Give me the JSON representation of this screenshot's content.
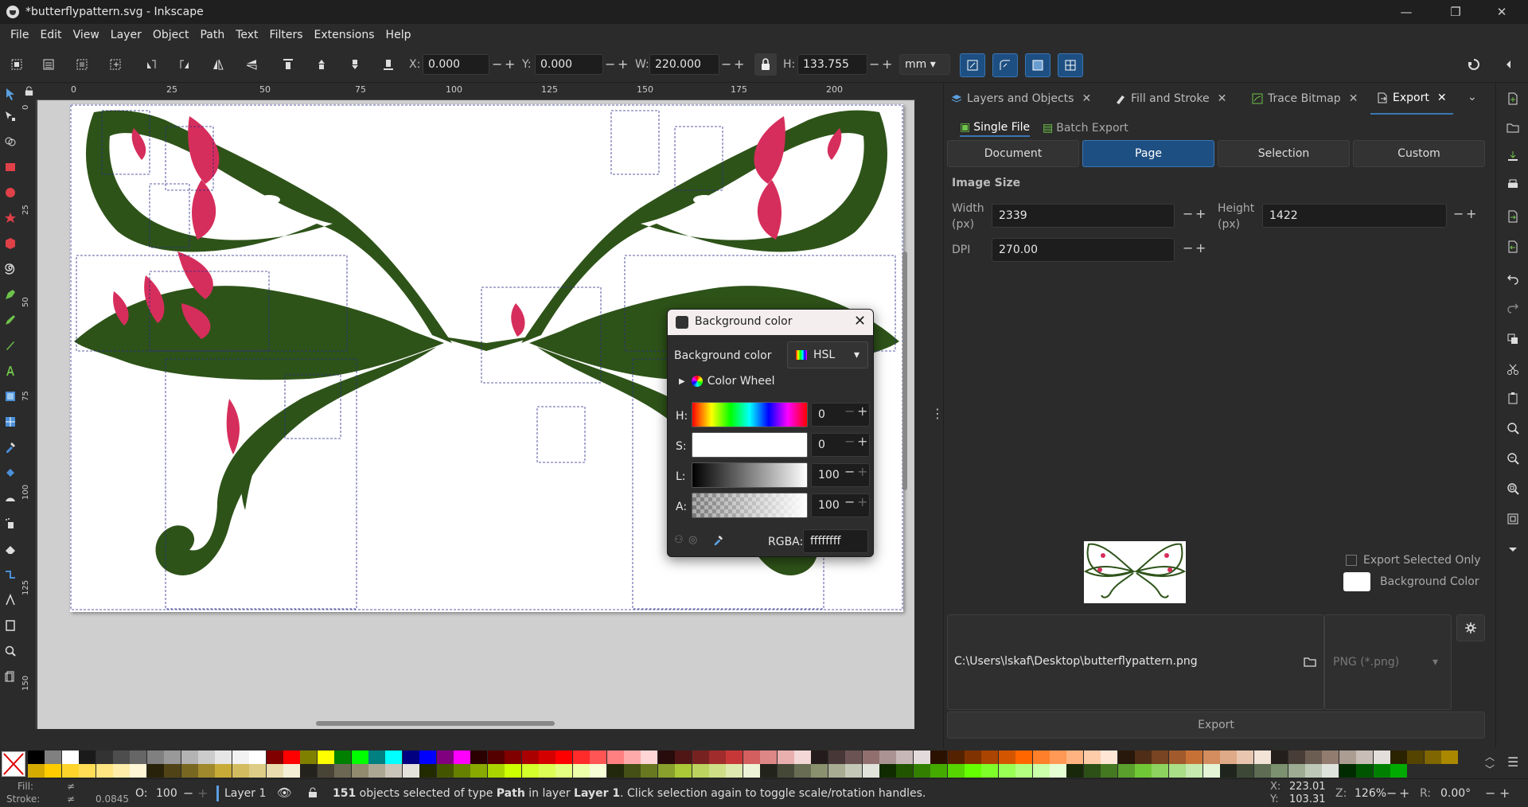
{
  "window": {
    "title": "*butterflypattern.svg - Inkscape",
    "minimize": "—",
    "maximize": "❐",
    "close": "✕"
  },
  "menu": [
    "File",
    "Edit",
    "View",
    "Layer",
    "Object",
    "Path",
    "Text",
    "Filters",
    "Extensions",
    "Help"
  ],
  "toolbar": {
    "x_label": "X:",
    "x_value": "0.000",
    "y_label": "Y:",
    "y_value": "0.000",
    "w_label": "W:",
    "w_value": "220.000",
    "h_label": "H:",
    "h_value": "133.755",
    "unit": "mm",
    "minus": "−",
    "plus": "+"
  },
  "ruler": {
    "h_ticks": [
      "0",
      "25",
      "50",
      "75",
      "100",
      "125",
      "150",
      "175",
      "200"
    ],
    "v_ticks": [
      "0",
      "25",
      "50",
      "75",
      "100",
      "125",
      "150"
    ]
  },
  "panel": {
    "tabs": [
      "Layers and Objects",
      "Fill and Stroke",
      "Trace Bitmap",
      "Export"
    ],
    "subtabs": [
      "Single File",
      "Batch Export"
    ],
    "area_buttons": [
      "Document",
      "Page",
      "Selection",
      "Custom"
    ],
    "image_size_label": "Image Size",
    "width_label": "Width",
    "width_unit": "(px)",
    "width_value": "2339",
    "height_label": "Height",
    "height_unit": "(px)",
    "height_value": "1422",
    "dpi_label": "DPI",
    "dpi_value": "270.00",
    "export_selected_only": "Export Selected Only",
    "background_color": "Background Color",
    "filename": "C:\\Users\\lskaf\\Desktop\\butterflypattern.png",
    "format": "PNG (*.png)",
    "export_button": "Export"
  },
  "dialog": {
    "title": "Background color",
    "label": "Background color",
    "mode": "HSL",
    "color_wheel": "Color Wheel",
    "h_label": "H:",
    "h_value": "0",
    "s_label": "S:",
    "s_value": "0",
    "l_label": "L:",
    "l_value": "100",
    "a_label": "A:",
    "a_value": "100",
    "rgba_label": "RGBA:",
    "rgba_value": "ffffffff"
  },
  "status": {
    "fill_label": "Fill:",
    "fill_value": "≠",
    "stroke_label": "Stroke:",
    "stroke_value": "≠",
    "stroke_width": "0.0845",
    "opacity_label": "O:",
    "opacity_value": "100",
    "layer": "Layer 1",
    "message_count": "151",
    "message_rest_1": " objects selected of type ",
    "message_type": "Path",
    "message_rest_2": " in layer ",
    "message_layer": "Layer 1",
    "message_rest_3": ". Click selection again to toggle scale/rotation handles.",
    "x_label": "X:",
    "x_value": "223.01",
    "y_label": "Y:",
    "y_value": "103.31",
    "zoom_label": "Z:",
    "zoom_value": "126%",
    "rotation_label": "R:",
    "rotation_value": "0.00°"
  },
  "colors": {
    "accent": "#1e4f82",
    "wing_green": "#2e5319",
    "wing_pink": "#d62e5c"
  },
  "palette": {
    "row1": [
      "#000000",
      "#808080",
      "#ffffff",
      "#1a1a1a",
      "#333333",
      "#4d4d4d",
      "#666666",
      "#808080",
      "#999999",
      "#b3b3b3",
      "#cccccc",
      "#e6e6e6",
      "#f2f2f2",
      "#ffffff",
      "#800000",
      "#ff0000",
      "#808000",
      "#ffff00",
      "#008000",
      "#00ff00",
      "#008080",
      "#00ffff",
      "#000080",
      "#0000ff",
      "#800080",
      "#ff00ff",
      "#2b0000",
      "#550000",
      "#800000",
      "#aa0000",
      "#d40000",
      "#ff0000",
      "#ff2a2a",
      "#ff5555",
      "#ff8080",
      "#ffaaaa",
      "#ffd5d5",
      "#280b0b",
      "#501616",
      "#782121",
      "#a02c2c",
      "#c83737",
      "#d35f5f",
      "#de8787",
      "#e9afaf",
      "#f4d7d7",
      "#241c1c",
      "#483737",
      "#6c5353",
      "#916f6f",
      "#ac9393",
      "#c8b7b7",
      "#e3dbdb",
      "#2b1100",
      "#552200",
      "#803300",
      "#aa4400",
      "#d45500",
      "#ff6600",
      "#ff7f2a",
      "#ff9955",
      "#ffb380",
      "#ffccaa",
      "#ffe6d5",
      "#28170b",
      "#502d16",
      "#784421",
      "#a05a2c",
      "#c87137",
      "#d38d5f",
      "#deaa87",
      "#e9c6af",
      "#f4e3d7",
      "#241f1c",
      "#483e37",
      "#6c5d53",
      "#917c6f",
      "#ac9d93",
      "#c8beb7",
      "#e3dedb",
      "#2b2200",
      "#554400",
      "#806600",
      "#aa8800"
    ],
    "row2": [
      "#d4aa00",
      "#ffcc00",
      "#ffd42a",
      "#ffdd55",
      "#ffe680",
      "#ffeeaa",
      "#fff6d5",
      "#28220b",
      "#504416",
      "#786721",
      "#a0892c",
      "#c8ab37",
      "#d3bc5f",
      "#decd87",
      "#e9ddaf",
      "#f4eed7",
      "#24221c",
      "#484537",
      "#6c6753",
      "#918a6f",
      "#aca793",
      "#c8c4b7",
      "#e3e2db",
      "#222b00",
      "#445500",
      "#668000",
      "#88aa00",
      "#aad400",
      "#ccff00",
      "#d4ff2a",
      "#ddff55",
      "#e5ff80",
      "#eeffaa",
      "#f6ffd5",
      "#22280b",
      "#445016",
      "#677821",
      "#89a02c",
      "#abc837",
      "#bcd35f",
      "#cdde87",
      "#dde9af",
      "#eef4d7",
      "#22241c",
      "#454837",
      "#676c53",
      "#8a916f",
      "#a7ac93",
      "#c4c8b7",
      "#e2e3db",
      "#112b00",
      "#225500",
      "#338000",
      "#44aa00",
      "#55d400",
      "#66ff00",
      "#7fff2a",
      "#99ff55",
      "#b3ff80",
      "#ccffaa",
      "#e5ffd5",
      "#17280b",
      "#2d5016",
      "#447821",
      "#5aa02c",
      "#71c837",
      "#8dd35f",
      "#aade87",
      "#c6e9af",
      "#e3f4d7",
      "#1f241c",
      "#3e4837",
      "#5d6c53",
      "#7c916f",
      "#9dac93",
      "#bec8b7",
      "#dee3db",
      "#002b00",
      "#005500",
      "#008000",
      "#00aa00"
    ]
  }
}
